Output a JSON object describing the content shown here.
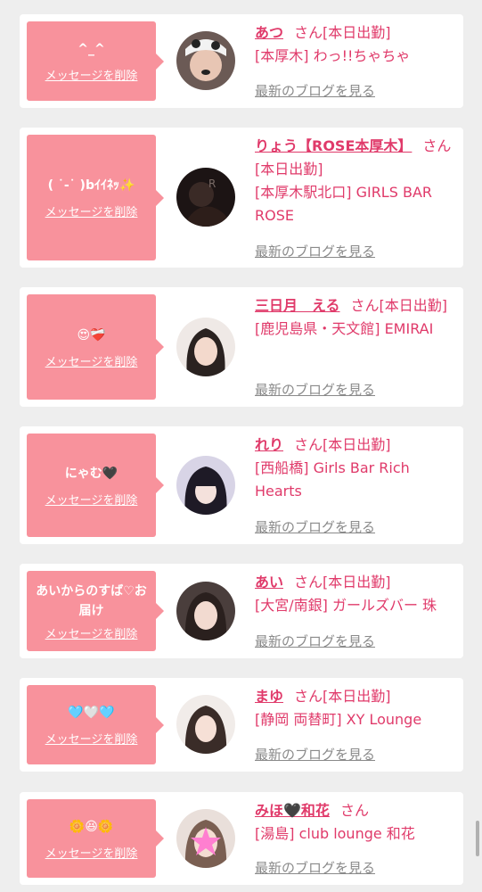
{
  "colors": {
    "bubble": "#f8929c",
    "accent": "#e03a6a",
    "link_gray": "#8a8a8a"
  },
  "common": {
    "delete_label": "メッセージを削除",
    "blog_label": "最新のブログを見る"
  },
  "items": [
    {
      "message": "^_^",
      "name": "あつ",
      "honorific": "さん",
      "status": "[本日出勤]",
      "shop": "[本厚木] わっ!!ちゃちゃ"
    },
    {
      "message": "( ˙-˙ )bｲｲﾈｯ✨",
      "name": "りょう【ROSE本厚木】",
      "honorific": "さん",
      "status": "[本日出勤]",
      "shop": "[本厚木駅北口] GIRLS BAR ROSE"
    },
    {
      "message": "😍❤️‍🩹",
      "name": "三日月　える",
      "honorific": "さん",
      "status": "[本日出勤]",
      "shop": "[鹿児島県・天文館] EMIRAI"
    },
    {
      "message": "にゃむ🖤",
      "name": "れり",
      "honorific": "さん",
      "status": "[本日出勤]",
      "shop": "[西船橋] Girls Bar Rich Hearts"
    },
    {
      "message": "あいからのすば♡お届け",
      "name": "あい",
      "honorific": "さん",
      "status": "[本日出勤]",
      "shop": "[大宮/南銀] ガールズバー 珠"
    },
    {
      "message": "🩵🤍🩵",
      "name": "まゆ",
      "honorific": "さん",
      "status": "[本日出勤]",
      "shop": "[静岡 両替町] XY Lounge"
    },
    {
      "message": "🌼😆🌼",
      "name": "みほ🖤和花",
      "honorific": "さん",
      "status": "",
      "shop": "[湯島] club lounge 和花"
    }
  ]
}
